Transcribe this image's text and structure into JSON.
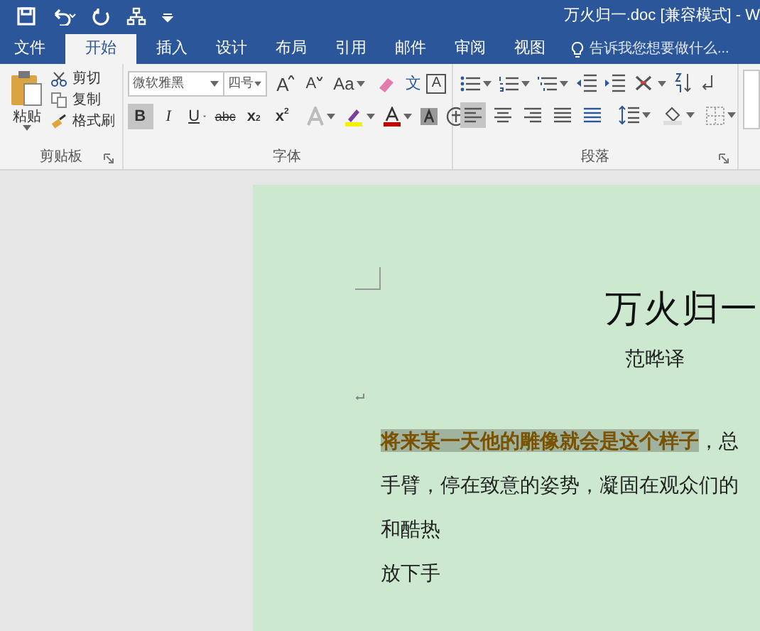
{
  "quick_access": [
    {
      "kind": "save"
    },
    {
      "kind": "undo"
    },
    {
      "kind": "redo"
    },
    {
      "kind": "tree"
    },
    {
      "kind": "customize"
    }
  ],
  "window": {
    "title": "万火归一.doc [兼容模式] - W"
  },
  "tabs": [
    {
      "label": "文件",
      "selected": false
    },
    {
      "label": "开始",
      "selected": true
    },
    {
      "label": "插入",
      "selected": false
    },
    {
      "label": "设计",
      "selected": false
    },
    {
      "label": "布局",
      "selected": false
    },
    {
      "label": "引用",
      "selected": false
    },
    {
      "label": "邮件",
      "selected": false
    },
    {
      "label": "审阅",
      "selected": false
    },
    {
      "label": "视图",
      "selected": false
    }
  ],
  "tell_me": {
    "placeholder": "告诉我您想要做什么..."
  },
  "clipboard": {
    "label": "剪贴板",
    "paste": "粘贴",
    "items": [
      {
        "kind": "cut",
        "label": "剪切"
      },
      {
        "kind": "copy",
        "label": "复制"
      },
      {
        "kind": "format_painter",
        "label": "格式刷"
      }
    ]
  },
  "font": {
    "label": "字体",
    "font_name": "微软雅黑",
    "font_size": "四号",
    "row1": [
      {
        "kind": "grow",
        "label": "A"
      },
      {
        "kind": "shrink",
        "label": "A"
      },
      {
        "kind": "case",
        "label": "Aa"
      },
      {
        "kind": "clear"
      },
      {
        "kind": "phonetic",
        "label": "文"
      },
      {
        "kind": "border",
        "label": "A"
      }
    ],
    "row2": [
      {
        "kind": "bold",
        "label": "B",
        "selected": true
      },
      {
        "kind": "italic",
        "label": "I",
        "selected": false
      },
      {
        "kind": "underline",
        "label": "U",
        "selected": false
      },
      {
        "kind": "strike",
        "label": "abc",
        "selected": false
      },
      {
        "kind": "sub",
        "label": "x",
        "index": "2",
        "selected": false
      },
      {
        "kind": "sup",
        "label": "x",
        "index": "2",
        "selected": false
      }
    ],
    "row2_icons": [
      {
        "kind": "effects"
      },
      {
        "kind": "highlight"
      },
      {
        "kind": "color"
      },
      {
        "kind": "shading"
      },
      {
        "kind": "enclose"
      }
    ]
  },
  "paragraph": {
    "label": "段落",
    "row1": [
      {
        "kind": "bullets"
      },
      {
        "kind": "numbering"
      },
      {
        "kind": "multilevel"
      },
      {
        "kind": "outdent"
      },
      {
        "kind": "indent"
      },
      {
        "kind": "asian"
      },
      {
        "kind": "sort"
      },
      {
        "kind": "marks"
      }
    ],
    "align": [
      {
        "kind": "left",
        "selected": true
      },
      {
        "kind": "center",
        "selected": false
      },
      {
        "kind": "right",
        "selected": false
      },
      {
        "kind": "justify",
        "selected": false
      },
      {
        "kind": "distributed",
        "selected": false
      }
    ],
    "row2": [
      {
        "kind": "spacing"
      },
      {
        "kind": "shading"
      },
      {
        "kind": "borders"
      }
    ]
  },
  "document": {
    "title": "万火归一",
    "author": "范晔译",
    "lines": [
      [
        {
          "text": "将来某一天他的雕像就会是这个样子",
          "highlighted": true
        },
        {
          "text": "，总",
          "highlighted": false
        }
      ],
      [
        {
          "text": "手臂，停在致意的姿势，凝固在观众们的",
          "highlighted": false
        }
      ],
      [
        {
          "text": "和酷热",
          "highlighted": false
        }
      ],
      [
        {
          "text": "放下手",
          "highlighted": false
        }
      ]
    ]
  }
}
